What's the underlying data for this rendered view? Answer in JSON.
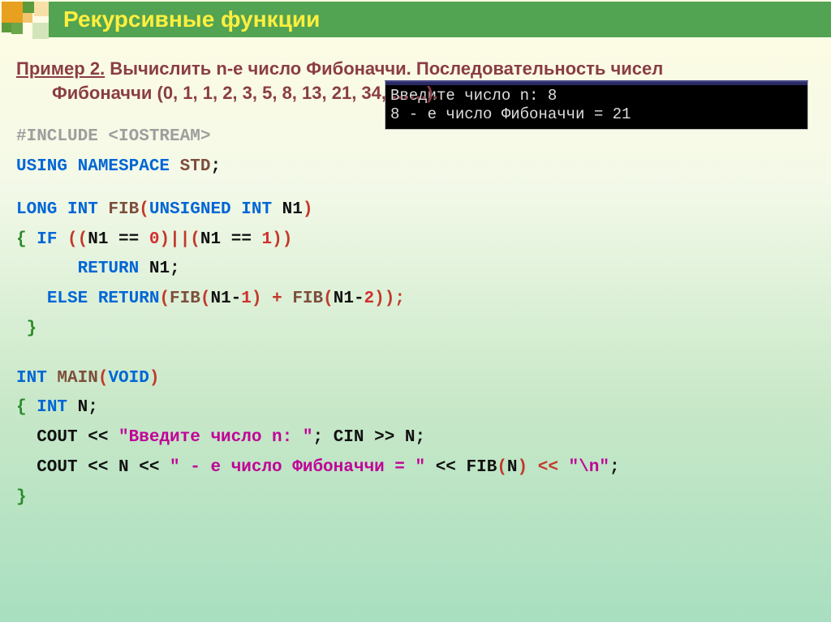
{
  "title": "Рекурсивные функции",
  "prompt": {
    "lead": "Пример 2.",
    "text": " Вычислить n-е число Фибоначчи. Последовательность чисел",
    "cont": "Фибоначчи (0, 1, 1, 2, 3, 5, 8, 13, 21, 34, ……)."
  },
  "console": {
    "line1": "Введите число n: 8",
    "line2": "8 - е число Фибоначчи = 21"
  },
  "code": {
    "l1a": "#INCLUDE ",
    "l1b": "<IOSTREAM>",
    "l2a": "USING",
    "l2b": " NAMESPACE ",
    "l2c": "STD",
    "l2d": ";",
    "l3a": "LONG  INT ",
    "l3b": "FIB",
    "l3c": "(",
    "l3d": "UNSIGNED INT ",
    "l3e": "N1",
    "l3f": ")",
    "l4a": " { ",
    "l4b": "IF ",
    "l4c": "((",
    "l4d": "N1 == ",
    "l4e": "0",
    "l4f": ")||(",
    "l4g": "N1 == ",
    "l4h": "1",
    "l4i": "))",
    "l5a": "      ",
    "l5b": "RETURN ",
    "l5c": "N1;",
    "l6a": "   ",
    "l6b": "ELSE RETURN",
    "l6c": "(",
    "l6d": "FIB",
    "l6e": "(",
    "l6f": "N1-",
    "l6g": "1",
    "l6h": ") + ",
    "l6i": "FIB",
    "l6j": "(",
    "l6k": "N1-",
    "l6l": "2",
    "l6m": "));",
    "l7": " }",
    "l8a": "INT ",
    "l8b": "MAIN",
    "l8c": "(",
    "l8d": "VOID",
    "l8e": ")",
    "l9a": "{ ",
    "l9b": "INT ",
    "l9c": "N;",
    "l10a": "  COUT << ",
    "l10b": "\"Введите число n: \"",
    "l10c": "; CIN >> N;",
    "l11a": "  COUT << N << ",
    "l11b": "\" - е число Фибоначчи = \"",
    "l11c": " << FIB",
    "l11d": "(",
    "l11e": "N",
    "l11f": ") << ",
    "l11g": "\"\\n\"",
    "l11h": ";",
    "l12": "}"
  }
}
